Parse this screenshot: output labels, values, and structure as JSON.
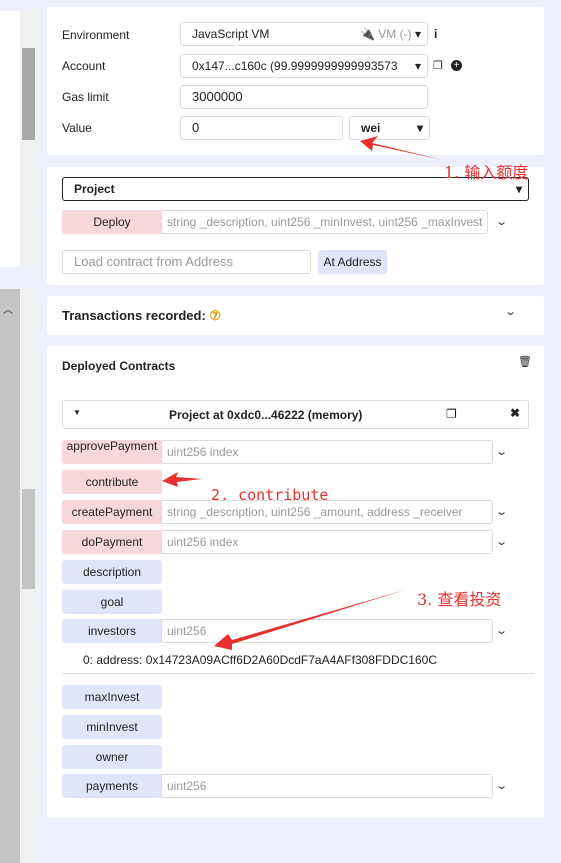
{
  "settings": {
    "environment_label": "Environment",
    "environment_value": "JavaScript VM",
    "environment_badge": "VM (-)",
    "account_label": "Account",
    "account_value": "0x147...c160c (99.9999999999993573",
    "gas_label": "Gas limit",
    "gas_value": "3000000",
    "value_label": "Value",
    "value_value": "0",
    "unit_value": "wei"
  },
  "deploy": {
    "contract_select": "Project",
    "deploy_label": "Deploy",
    "deploy_params": "string _description, uint256 _minInvest, uint256 _maxInvest",
    "load_placeholder": "Load contract from Address",
    "at_address_label": "At Address"
  },
  "transactions": {
    "label": "Transactions recorded:",
    "count": "⑦"
  },
  "deployed": {
    "title": "Deployed Contracts",
    "instance_title": "Project at 0xdc0...46222 (memory)",
    "functions": [
      {
        "name": "approvePayment",
        "params": "uint256 index"
      },
      {
        "name": "contribute",
        "params": ""
      },
      {
        "name": "createPayment",
        "params": "string _description, uint256 _amount, address _receiver"
      },
      {
        "name": "doPayment",
        "params": "uint256 index"
      },
      {
        "name": "description",
        "params": ""
      },
      {
        "name": "goal",
        "params": ""
      },
      {
        "name": "investors",
        "params": "uint256"
      },
      {
        "name": "maxInvest",
        "params": ""
      },
      {
        "name": "minInvest",
        "params": ""
      },
      {
        "name": "owner",
        "params": ""
      },
      {
        "name": "payments",
        "params": "uint256"
      }
    ],
    "investors_output": "0: address: 0x14723A09ACff6D2A60DcdF7aA4AFf308FDDC160C"
  },
  "annotations": {
    "step1": "1. 输入额度",
    "step2": "2. contribute",
    "step3": "3. 查看投资"
  },
  "colors": {
    "transact": "#f8d7da",
    "call": "#e1e5f9",
    "annotation": "#e8312e"
  }
}
